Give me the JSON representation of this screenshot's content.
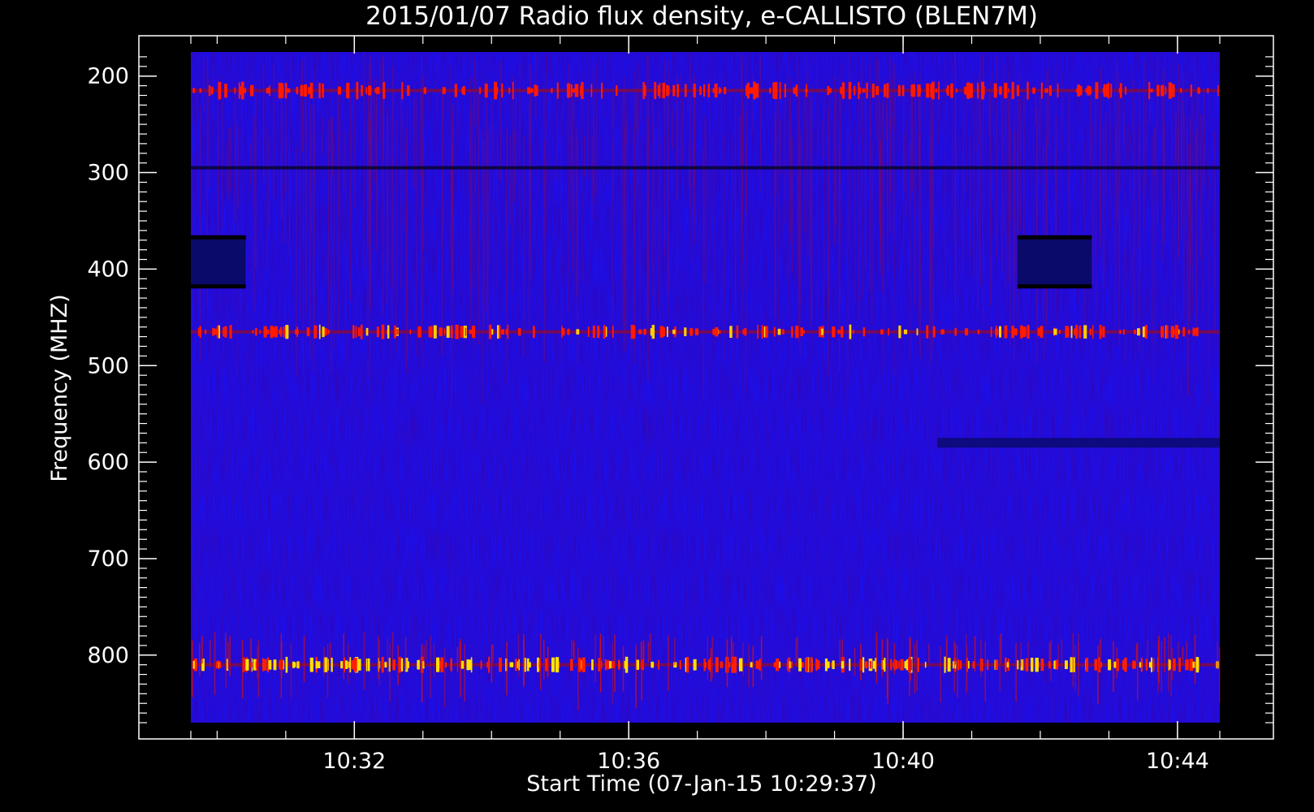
{
  "chart_data": {
    "type": "heatmap",
    "title": "2015/01/07  Radio flux density, e-CALLISTO (BLEN7M)",
    "xlabel": "Start Time (07-Jan-15 10:29:37)",
    "ylabel": "Frequency (MHZ)",
    "x_ticks": [
      "10:32",
      "10:36",
      "10:40",
      "10:44"
    ],
    "y_ticks": [
      "200",
      "300",
      "400",
      "500",
      "600",
      "700",
      "800"
    ],
    "y_tick_values": [
      200,
      300,
      400,
      500,
      600,
      700,
      800
    ],
    "ylim": [
      870,
      175
    ],
    "y_inverted": true,
    "data_frequency_range_mhz": [
      175,
      870
    ],
    "data_time_range": [
      "10:29:37",
      "10:44:37"
    ],
    "colormap": [
      "#000000",
      "#0000ff",
      "#ff0000",
      "#ffff00"
    ],
    "background_color": "#1a10f0",
    "features": [
      {
        "kind": "rfi_band",
        "freq_mhz": 215,
        "intensity": "red"
      },
      {
        "kind": "rfi_band",
        "freq_mhz": 295,
        "intensity": "dark"
      },
      {
        "kind": "rfi_band",
        "freq_mhz": 465,
        "intensity": "red-yellow"
      },
      {
        "kind": "rfi_band",
        "freq_mhz": 810,
        "intensity": "yellow"
      },
      {
        "kind": "dark_block",
        "freq_range_mhz": [
          365,
          420
        ],
        "time_range": [
          "10:29:37",
          "10:30:25"
        ]
      },
      {
        "kind": "dark_block",
        "freq_range_mhz": [
          365,
          420
        ],
        "time_range": [
          "10:41:40",
          "10:42:45"
        ]
      },
      {
        "kind": "dark_band",
        "freq_mhz": 580,
        "time_range": [
          "10:40:30",
          "10:44:37"
        ]
      }
    ]
  }
}
